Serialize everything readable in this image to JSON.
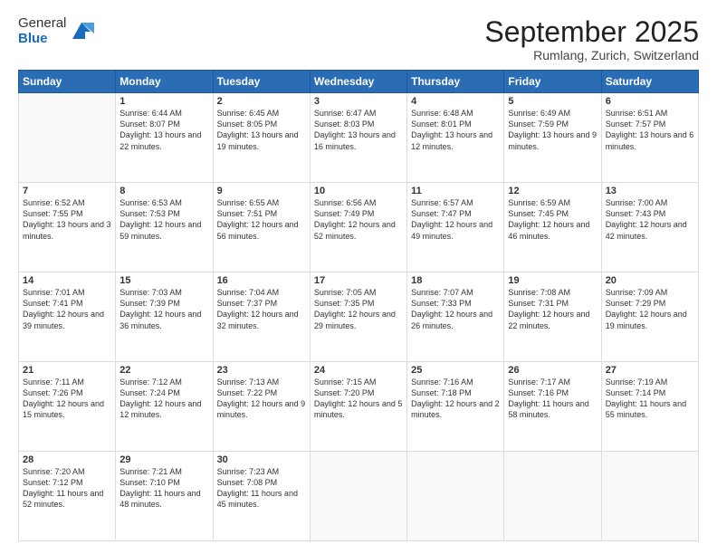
{
  "logo": {
    "general": "General",
    "blue": "Blue"
  },
  "header": {
    "month": "September 2025",
    "location": "Rumlang, Zurich, Switzerland"
  },
  "weekdays": [
    "Sunday",
    "Monday",
    "Tuesday",
    "Wednesday",
    "Thursday",
    "Friday",
    "Saturday"
  ],
  "weeks": [
    [
      {
        "day": "",
        "sunrise": "",
        "sunset": "",
        "daylight": ""
      },
      {
        "day": "1",
        "sunrise": "Sunrise: 6:44 AM",
        "sunset": "Sunset: 8:07 PM",
        "daylight": "Daylight: 13 hours and 22 minutes."
      },
      {
        "day": "2",
        "sunrise": "Sunrise: 6:45 AM",
        "sunset": "Sunset: 8:05 PM",
        "daylight": "Daylight: 13 hours and 19 minutes."
      },
      {
        "day": "3",
        "sunrise": "Sunrise: 6:47 AM",
        "sunset": "Sunset: 8:03 PM",
        "daylight": "Daylight: 13 hours and 16 minutes."
      },
      {
        "day": "4",
        "sunrise": "Sunrise: 6:48 AM",
        "sunset": "Sunset: 8:01 PM",
        "daylight": "Daylight: 13 hours and 12 minutes."
      },
      {
        "day": "5",
        "sunrise": "Sunrise: 6:49 AM",
        "sunset": "Sunset: 7:59 PM",
        "daylight": "Daylight: 13 hours and 9 minutes."
      },
      {
        "day": "6",
        "sunrise": "Sunrise: 6:51 AM",
        "sunset": "Sunset: 7:57 PM",
        "daylight": "Daylight: 13 hours and 6 minutes."
      }
    ],
    [
      {
        "day": "7",
        "sunrise": "Sunrise: 6:52 AM",
        "sunset": "Sunset: 7:55 PM",
        "daylight": "Daylight: 13 hours and 3 minutes."
      },
      {
        "day": "8",
        "sunrise": "Sunrise: 6:53 AM",
        "sunset": "Sunset: 7:53 PM",
        "daylight": "Daylight: 12 hours and 59 minutes."
      },
      {
        "day": "9",
        "sunrise": "Sunrise: 6:55 AM",
        "sunset": "Sunset: 7:51 PM",
        "daylight": "Daylight: 12 hours and 56 minutes."
      },
      {
        "day": "10",
        "sunrise": "Sunrise: 6:56 AM",
        "sunset": "Sunset: 7:49 PM",
        "daylight": "Daylight: 12 hours and 52 minutes."
      },
      {
        "day": "11",
        "sunrise": "Sunrise: 6:57 AM",
        "sunset": "Sunset: 7:47 PM",
        "daylight": "Daylight: 12 hours and 49 minutes."
      },
      {
        "day": "12",
        "sunrise": "Sunrise: 6:59 AM",
        "sunset": "Sunset: 7:45 PM",
        "daylight": "Daylight: 12 hours and 46 minutes."
      },
      {
        "day": "13",
        "sunrise": "Sunrise: 7:00 AM",
        "sunset": "Sunset: 7:43 PM",
        "daylight": "Daylight: 12 hours and 42 minutes."
      }
    ],
    [
      {
        "day": "14",
        "sunrise": "Sunrise: 7:01 AM",
        "sunset": "Sunset: 7:41 PM",
        "daylight": "Daylight: 12 hours and 39 minutes."
      },
      {
        "day": "15",
        "sunrise": "Sunrise: 7:03 AM",
        "sunset": "Sunset: 7:39 PM",
        "daylight": "Daylight: 12 hours and 36 minutes."
      },
      {
        "day": "16",
        "sunrise": "Sunrise: 7:04 AM",
        "sunset": "Sunset: 7:37 PM",
        "daylight": "Daylight: 12 hours and 32 minutes."
      },
      {
        "day": "17",
        "sunrise": "Sunrise: 7:05 AM",
        "sunset": "Sunset: 7:35 PM",
        "daylight": "Daylight: 12 hours and 29 minutes."
      },
      {
        "day": "18",
        "sunrise": "Sunrise: 7:07 AM",
        "sunset": "Sunset: 7:33 PM",
        "daylight": "Daylight: 12 hours and 26 minutes."
      },
      {
        "day": "19",
        "sunrise": "Sunrise: 7:08 AM",
        "sunset": "Sunset: 7:31 PM",
        "daylight": "Daylight: 12 hours and 22 minutes."
      },
      {
        "day": "20",
        "sunrise": "Sunrise: 7:09 AM",
        "sunset": "Sunset: 7:29 PM",
        "daylight": "Daylight: 12 hours and 19 minutes."
      }
    ],
    [
      {
        "day": "21",
        "sunrise": "Sunrise: 7:11 AM",
        "sunset": "Sunset: 7:26 PM",
        "daylight": "Daylight: 12 hours and 15 minutes."
      },
      {
        "day": "22",
        "sunrise": "Sunrise: 7:12 AM",
        "sunset": "Sunset: 7:24 PM",
        "daylight": "Daylight: 12 hours and 12 minutes."
      },
      {
        "day": "23",
        "sunrise": "Sunrise: 7:13 AM",
        "sunset": "Sunset: 7:22 PM",
        "daylight": "Daylight: 12 hours and 9 minutes."
      },
      {
        "day": "24",
        "sunrise": "Sunrise: 7:15 AM",
        "sunset": "Sunset: 7:20 PM",
        "daylight": "Daylight: 12 hours and 5 minutes."
      },
      {
        "day": "25",
        "sunrise": "Sunrise: 7:16 AM",
        "sunset": "Sunset: 7:18 PM",
        "daylight": "Daylight: 12 hours and 2 minutes."
      },
      {
        "day": "26",
        "sunrise": "Sunrise: 7:17 AM",
        "sunset": "Sunset: 7:16 PM",
        "daylight": "Daylight: 11 hours and 58 minutes."
      },
      {
        "day": "27",
        "sunrise": "Sunrise: 7:19 AM",
        "sunset": "Sunset: 7:14 PM",
        "daylight": "Daylight: 11 hours and 55 minutes."
      }
    ],
    [
      {
        "day": "28",
        "sunrise": "Sunrise: 7:20 AM",
        "sunset": "Sunset: 7:12 PM",
        "daylight": "Daylight: 11 hours and 52 minutes."
      },
      {
        "day": "29",
        "sunrise": "Sunrise: 7:21 AM",
        "sunset": "Sunset: 7:10 PM",
        "daylight": "Daylight: 11 hours and 48 minutes."
      },
      {
        "day": "30",
        "sunrise": "Sunrise: 7:23 AM",
        "sunset": "Sunset: 7:08 PM",
        "daylight": "Daylight: 11 hours and 45 minutes."
      },
      {
        "day": "",
        "sunrise": "",
        "sunset": "",
        "daylight": ""
      },
      {
        "day": "",
        "sunrise": "",
        "sunset": "",
        "daylight": ""
      },
      {
        "day": "",
        "sunrise": "",
        "sunset": "",
        "daylight": ""
      },
      {
        "day": "",
        "sunrise": "",
        "sunset": "",
        "daylight": ""
      }
    ]
  ]
}
